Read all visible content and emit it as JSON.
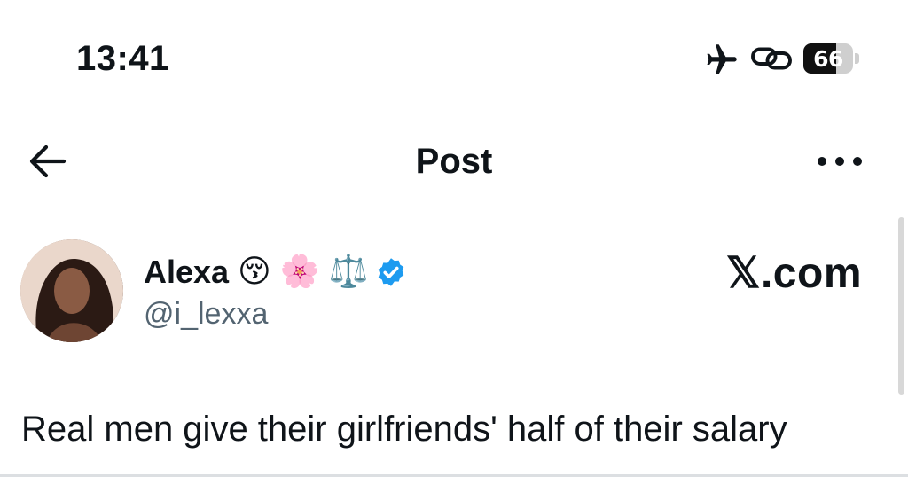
{
  "status_bar": {
    "time": "13:41",
    "icons": [
      "airplane-mode-icon",
      "link-icon"
    ],
    "battery_level": "66",
    "battery_fraction": 0.66
  },
  "nav": {
    "title": "Post",
    "back_icon": "arrow-left-icon",
    "more_icon": "more-horizontal-icon"
  },
  "post": {
    "author": {
      "display_name": "Alexa",
      "emojis": [
        "😚",
        "🌸",
        "⚖️"
      ],
      "verified": true,
      "handle": "@i_lexxa"
    },
    "brand": "𝕏.com",
    "text": "Real men give their girlfriends' half of their salary"
  },
  "colors": {
    "text_primary": "#0f1419",
    "text_secondary": "#536471",
    "verified_blue": "#1d9bf0"
  }
}
